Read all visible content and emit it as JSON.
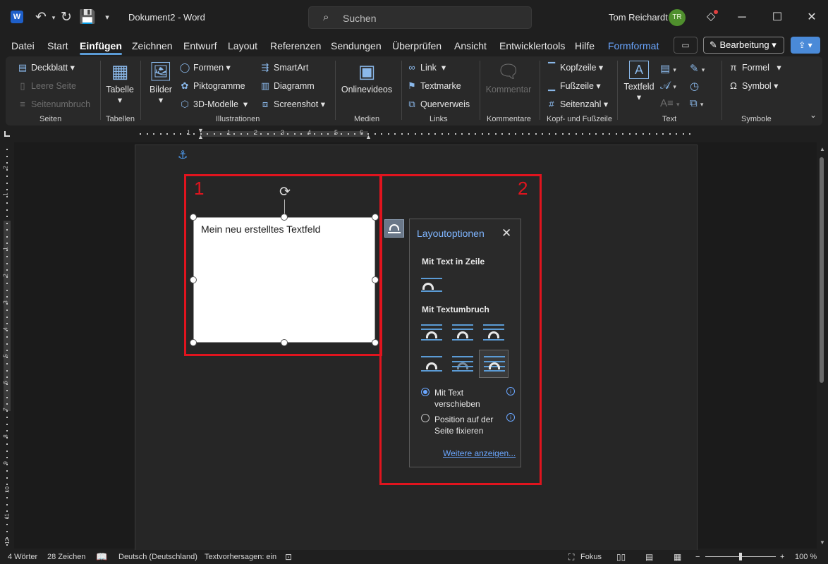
{
  "titlebar": {
    "app_letter": "W",
    "undo_icon": "undo-icon",
    "redo_icon": "redo-icon",
    "save_icon": "save-icon",
    "document_title": "Dokument2  -  Word",
    "search_placeholder": "Suchen",
    "user_name": "Tom Reichardt",
    "user_initials": "TR",
    "window_controls": [
      "minimize-icon",
      "maximize-icon",
      "close-icon"
    ]
  },
  "menu": {
    "items": [
      "Datei",
      "Start",
      "Einfügen",
      "Zeichnen",
      "Entwurf",
      "Layout",
      "Referenzen",
      "Sendungen",
      "Überprüfen",
      "Ansicht",
      "Entwicklertools",
      "Hilfe",
      "Formformat"
    ],
    "active": "Einfügen",
    "context_tab": "Formformat",
    "edit_mode_label": "Bearbeitung"
  },
  "ribbon": {
    "groups": {
      "seiten": {
        "label": "Seiten",
        "items": [
          "Deckblatt",
          "Leere Seite",
          "Seitenumbruch"
        ]
      },
      "tabellen": {
        "label": "Tabellen",
        "items": [
          "Tabelle"
        ]
      },
      "illustrationen": {
        "label": "Illustrationen",
        "items": [
          "Bilder",
          "Formen",
          "Piktogramme",
          "3D-Modelle",
          "SmartArt",
          "Diagramm",
          "Screenshot"
        ]
      },
      "medien": {
        "label": "Medien",
        "items": [
          "Onlinevideos"
        ]
      },
      "links": {
        "label": "Links",
        "items": [
          "Link",
          "Textmarke",
          "Querverweis"
        ]
      },
      "kommentare": {
        "label": "Kommentare",
        "items": [
          "Kommentar"
        ]
      },
      "kopf_fusszeile": {
        "label": "Kopf- und Fußzeile",
        "items": [
          "Kopfzeile",
          "Fußzeile",
          "Seitenzahl"
        ]
      },
      "text": {
        "label": "Text",
        "items": [
          "Textfeld"
        ]
      },
      "symbole": {
        "label": "Symbole",
        "items": [
          "Formel",
          "Symbol"
        ]
      }
    }
  },
  "ruler": {
    "h_numbers": [
      "1",
      "1",
      "2",
      "3",
      "4",
      "5",
      "6"
    ],
    "v_numbers": [
      "2",
      "1",
      "1",
      "1",
      "2",
      "3",
      "4",
      "5",
      "6",
      "7",
      "8",
      "9",
      "10",
      "11",
      "12"
    ]
  },
  "document": {
    "annotation_1": "1",
    "annotation_2": "2",
    "textbox_text": "Mein neu erstelltes Textfeld"
  },
  "layout_options": {
    "title": "Layoutoptionen",
    "section_inline": "Mit Text in Zeile",
    "section_wrap": "Mit Textumbruch",
    "option_move": "Mit Text verschieben",
    "option_fix": "Position auf der Seite fixieren",
    "selected_option": "Mit Text verschieben",
    "more_link": "Weitere anzeigen..."
  },
  "statusbar": {
    "words": "4 Wörter",
    "chars": "28 Zeichen",
    "language": "Deutsch (Deutschland)",
    "predictions": "Textvorhersagen: ein",
    "focus": "Fokus",
    "zoom_minus": "−",
    "zoom_plus": "+",
    "zoom": "100 %"
  },
  "colors": {
    "accent": "#5b9bd5",
    "link": "#6aa6ff",
    "annotation_red": "#e0141e",
    "avatar_green": "#4f8f2d"
  }
}
